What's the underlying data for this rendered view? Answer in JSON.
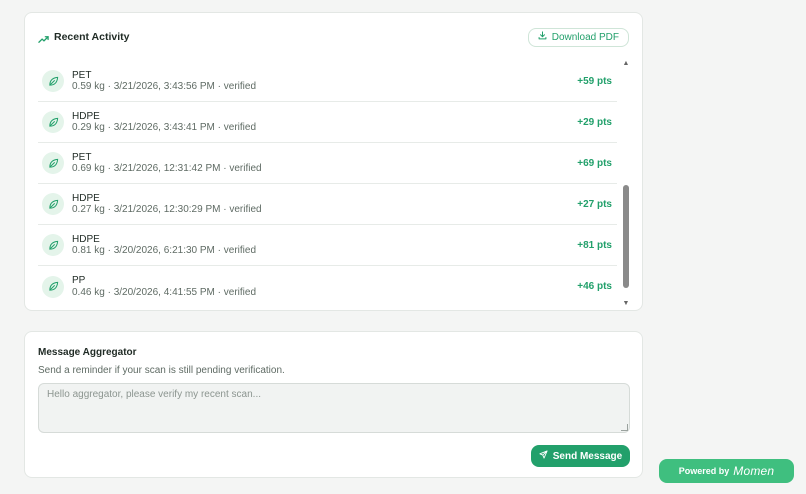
{
  "activity": {
    "title": "Recent Activity",
    "download_label": "Download PDF",
    "items": [
      {
        "type": "PET",
        "meta": "0.59 kg · 3/21/2026, 3:43:56 PM · verified",
        "points": "+59 pts"
      },
      {
        "type": "HDPE",
        "meta": "0.29 kg · 3/21/2026, 3:43:41 PM · verified",
        "points": "+29 pts"
      },
      {
        "type": "PET",
        "meta": "0.69 kg · 3/21/2026, 12:31:42 PM · verified",
        "points": "+69 pts"
      },
      {
        "type": "HDPE",
        "meta": "0.27 kg · 3/21/2026, 12:30:29 PM · verified",
        "points": "+27 pts"
      },
      {
        "type": "HDPE",
        "meta": "0.81 kg · 3/20/2026, 6:21:30 PM · verified",
        "points": "+81 pts"
      },
      {
        "type": "PP",
        "meta": "0.46 kg · 3/20/2026, 4:41:55 PM · verified",
        "points": "+46 pts"
      }
    ],
    "icons": {
      "header": "trending-up-icon",
      "download": "download-icon",
      "item": "leaf-icon"
    }
  },
  "message": {
    "title": "Message Aggregator",
    "subtitle": "Send a reminder if your scan is still pending verification.",
    "placeholder": "Hello aggregator, please verify my recent scan...",
    "value": "",
    "send_label": "Send Message",
    "send_icon": "send-icon"
  },
  "footer": {
    "powered_label": "Powered by",
    "brand": "Momen"
  },
  "colors": {
    "accent": "#22a06b",
    "accent_light": "#e4f4ea",
    "badge_bg": "#3fbf7f",
    "page_bg": "#f4f5f4"
  }
}
